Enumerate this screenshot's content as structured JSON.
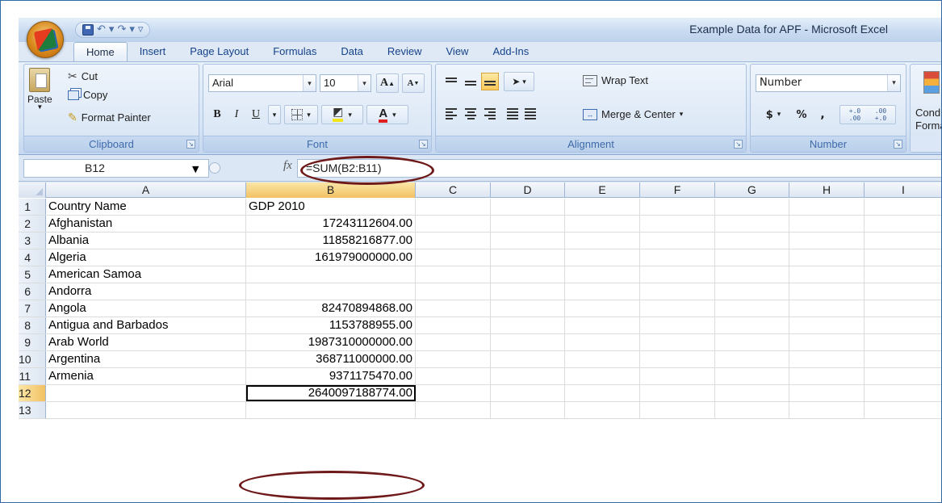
{
  "window": {
    "title": "Example Data for APF - Microsoft Excel"
  },
  "tabs": [
    {
      "label": "Home",
      "active": true
    },
    {
      "label": "Insert"
    },
    {
      "label": "Page Layout"
    },
    {
      "label": "Formulas"
    },
    {
      "label": "Data"
    },
    {
      "label": "Review"
    },
    {
      "label": "View"
    },
    {
      "label": "Add-Ins"
    }
  ],
  "ribbon": {
    "clipboard": {
      "label": "Clipboard",
      "paste": "Paste",
      "cut": "Cut",
      "copy": "Copy",
      "format_painter": "Format Painter"
    },
    "font": {
      "label": "Font",
      "font_name": "Arial",
      "font_size": "10",
      "grow": "A",
      "shrink": "A",
      "bold": "B",
      "italic": "I",
      "underline": "U",
      "font_color": "A"
    },
    "alignment": {
      "label": "Alignment",
      "wrap_text": "Wrap Text",
      "merge_center": "Merge & Center"
    },
    "number": {
      "label": "Number",
      "format": "Number",
      "currency": "$",
      "percent": "%",
      "comma": ",",
      "inc_decimal": "+.0 .00",
      "dec_decimal": ".00 +.0"
    },
    "styles": {
      "conditional_line1": "Cond",
      "conditional_line2": "Forma"
    }
  },
  "formula_bar": {
    "name_box": "B12",
    "fx": "fx",
    "formula": "=SUM(B2:B11)"
  },
  "sheet": {
    "columns": [
      "A",
      "B",
      "C",
      "D",
      "E",
      "F",
      "G",
      "H",
      "I"
    ],
    "selected_column": "B",
    "selected_row": 12,
    "rows": [
      {
        "num": "1",
        "a": "Country Name",
        "b": "GDP 2010"
      },
      {
        "num": "2",
        "a": "Afghanistan",
        "b": "17243112604.00"
      },
      {
        "num": "3",
        "a": "Albania",
        "b": "11858216877.00"
      },
      {
        "num": "4",
        "a": "Algeria",
        "b": "161979000000.00"
      },
      {
        "num": "5",
        "a": "American Samoa",
        "b": ""
      },
      {
        "num": "6",
        "a": "Andorra",
        "b": ""
      },
      {
        "num": "7",
        "a": "Angola",
        "b": "82470894868.00"
      },
      {
        "num": "8",
        "a": "Antigua and Barbados",
        "b": "1153788955.00"
      },
      {
        "num": "9",
        "a": "Arab World",
        "b": "1987310000000.00"
      },
      {
        "num": "10",
        "a": "Argentina",
        "b": "368711000000.00"
      },
      {
        "num": "11",
        "a": "Armenia",
        "b": "9371175470.00"
      },
      {
        "num": "12",
        "a": "",
        "b": "2640097188774.00"
      },
      {
        "num": "13",
        "a": "",
        "b": ""
      }
    ]
  },
  "colors": {
    "annotation_ellipse": "#6f1a1a",
    "selected_header": "#f2c164",
    "ribbon_text": "#15428b"
  }
}
